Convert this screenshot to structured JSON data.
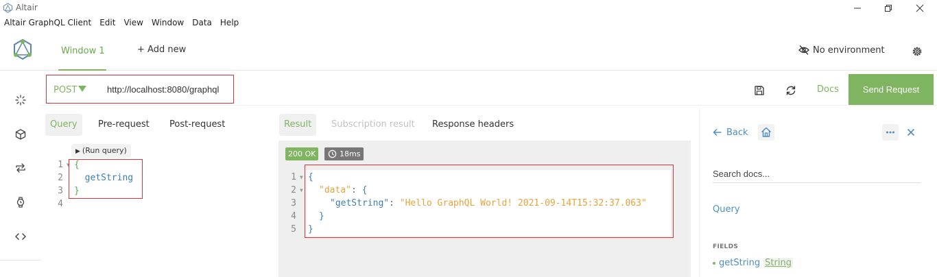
{
  "titlebar": {
    "title": "Altair"
  },
  "menu": [
    "Altair GraphQL Client",
    "Edit",
    "View",
    "Window",
    "Data",
    "Help"
  ],
  "header": {
    "window_tab": "Window 1",
    "add_new": "+ Add new",
    "environment": "No environment"
  },
  "request": {
    "method": "POST",
    "url": "http://localhost:8080/graphql",
    "docs_label": "Docs",
    "send_label": "Send Request"
  },
  "query_tabs": [
    "Query",
    "Pre-request",
    "Post-request"
  ],
  "run_query": "(Run query)",
  "query_editor": {
    "line_numbers": [
      "1",
      "2",
      "3",
      "4"
    ],
    "lines": [
      "{",
      "  getString",
      "}",
      ""
    ]
  },
  "result_tabs": [
    "Result",
    "Subscription result",
    "Response headers"
  ],
  "result_status": {
    "status": "200 OK",
    "time": "18ms"
  },
  "result_editor": {
    "line_numbers": [
      "1",
      "2",
      "3",
      "4",
      "5"
    ],
    "brace_open": "{",
    "data_key": "\"data\"",
    "colon": ":",
    "inner_open": "{",
    "getstring_key": "\"getString\"",
    "getstring_value": "\"Hello GraphQL World! 2021-09-14T15:32:37.063\"",
    "inner_close": "}",
    "brace_close": "}"
  },
  "docs_panel": {
    "back_label": "Back",
    "search_placeholder": "Search docs...",
    "root_type": "Query",
    "fields_heading": "FIELDS",
    "fields": [
      {
        "name": "getString",
        "type": "String"
      }
    ]
  },
  "colors": {
    "accent": "#7fb561",
    "link": "#4a8ec2",
    "highlight_box": "#d9323a"
  }
}
